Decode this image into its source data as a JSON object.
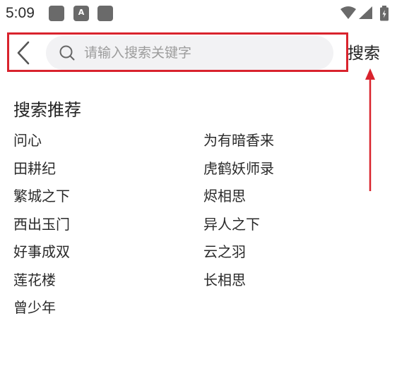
{
  "status_bar": {
    "time": "5:09",
    "notification_icons": [
      "app-notification-icon",
      "autofill-a-icon",
      "app-notification-icon"
    ],
    "system_icons": [
      "wifi-icon",
      "signal-icon",
      "battery-icon"
    ],
    "notif_a_glyph": "A"
  },
  "search_bar": {
    "back_icon": "chevron-left-icon",
    "search_icon": "search-icon",
    "placeholder": "请输入搜索关键字",
    "value": "",
    "search_button_label": "搜索"
  },
  "annotation": {
    "highlight_color": "#d9232d",
    "arrow_color": "#d9232d"
  },
  "recommendations": {
    "title": "搜索推荐",
    "items": [
      "问心",
      "为有暗香来",
      "田耕纪",
      "虎鹤妖师录",
      "繁城之下",
      "烬相思",
      "西出玉门",
      "异人之下",
      "好事成双",
      "云之羽",
      "莲花楼",
      "长相思",
      "曾少年"
    ]
  },
  "colors": {
    "background": "#ffffff",
    "search_box_bg": "#f2f2f4",
    "text_primary": "#222222",
    "placeholder": "#9c9c9c",
    "status_icons": "#6a6a6a"
  }
}
